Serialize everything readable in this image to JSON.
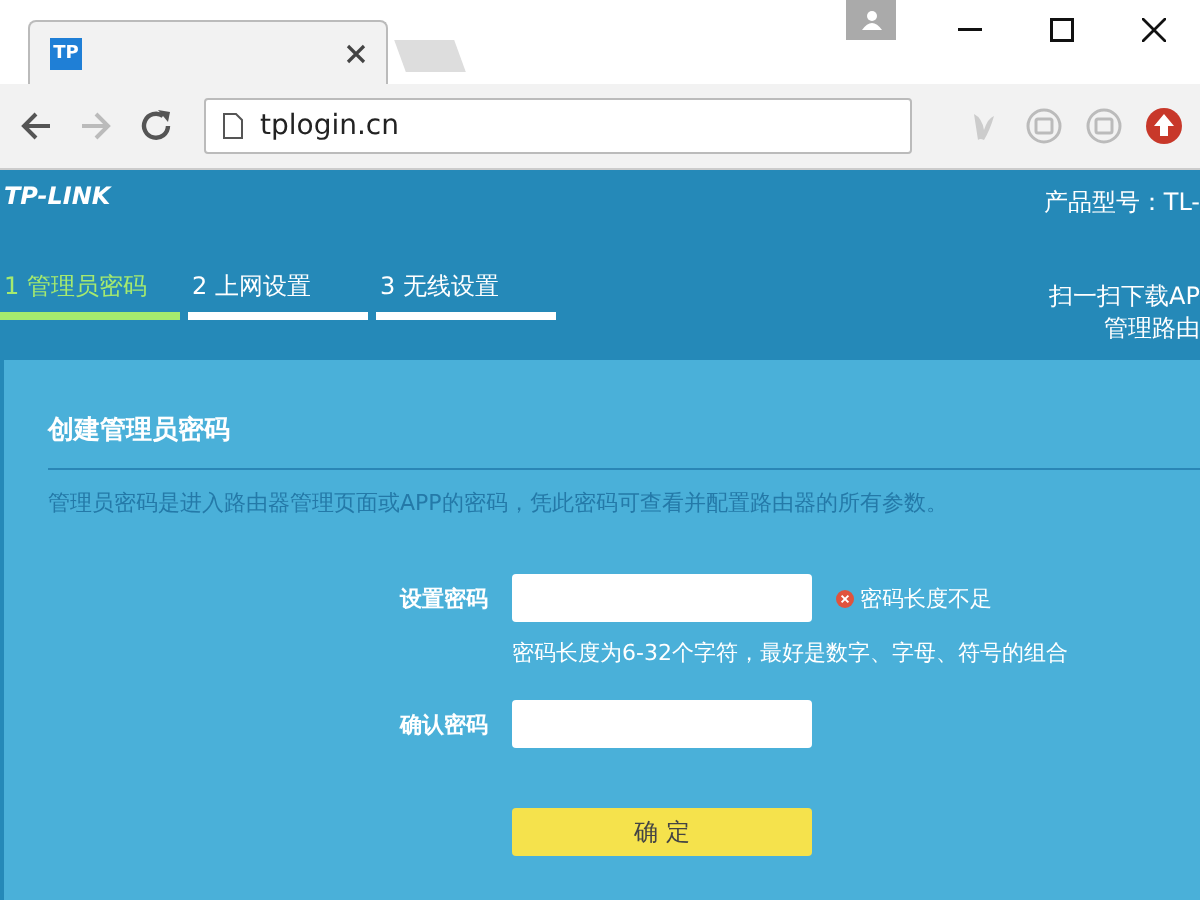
{
  "browser": {
    "tab": {
      "favicon": "TP",
      "selected": true
    },
    "address": "tplogin.cn"
  },
  "header": {
    "logo": "TP-LINK",
    "model": "产品型号：TL-",
    "steps": [
      {
        "label": "1 管理员密码",
        "selected": true
      },
      {
        "label": "2 上网设置",
        "selected": false
      },
      {
        "label": "3 无线设置",
        "selected": false
      }
    ],
    "app_promo": [
      "扫一扫下载AP",
      "管理路由"
    ]
  },
  "form": {
    "title": "创建管理员密码",
    "description": "管理员密码是进入路由器管理页面或APP的密码，凭此密码可查看并配置路由器的所有参数。",
    "fields": [
      {
        "label": "设置密码",
        "error": "密码长度不足",
        "hint": "密码长度为6-32个字符，最好是数字、字母、符号的组合"
      },
      {
        "label": "确认密码"
      }
    ],
    "submit": "确 定"
  }
}
